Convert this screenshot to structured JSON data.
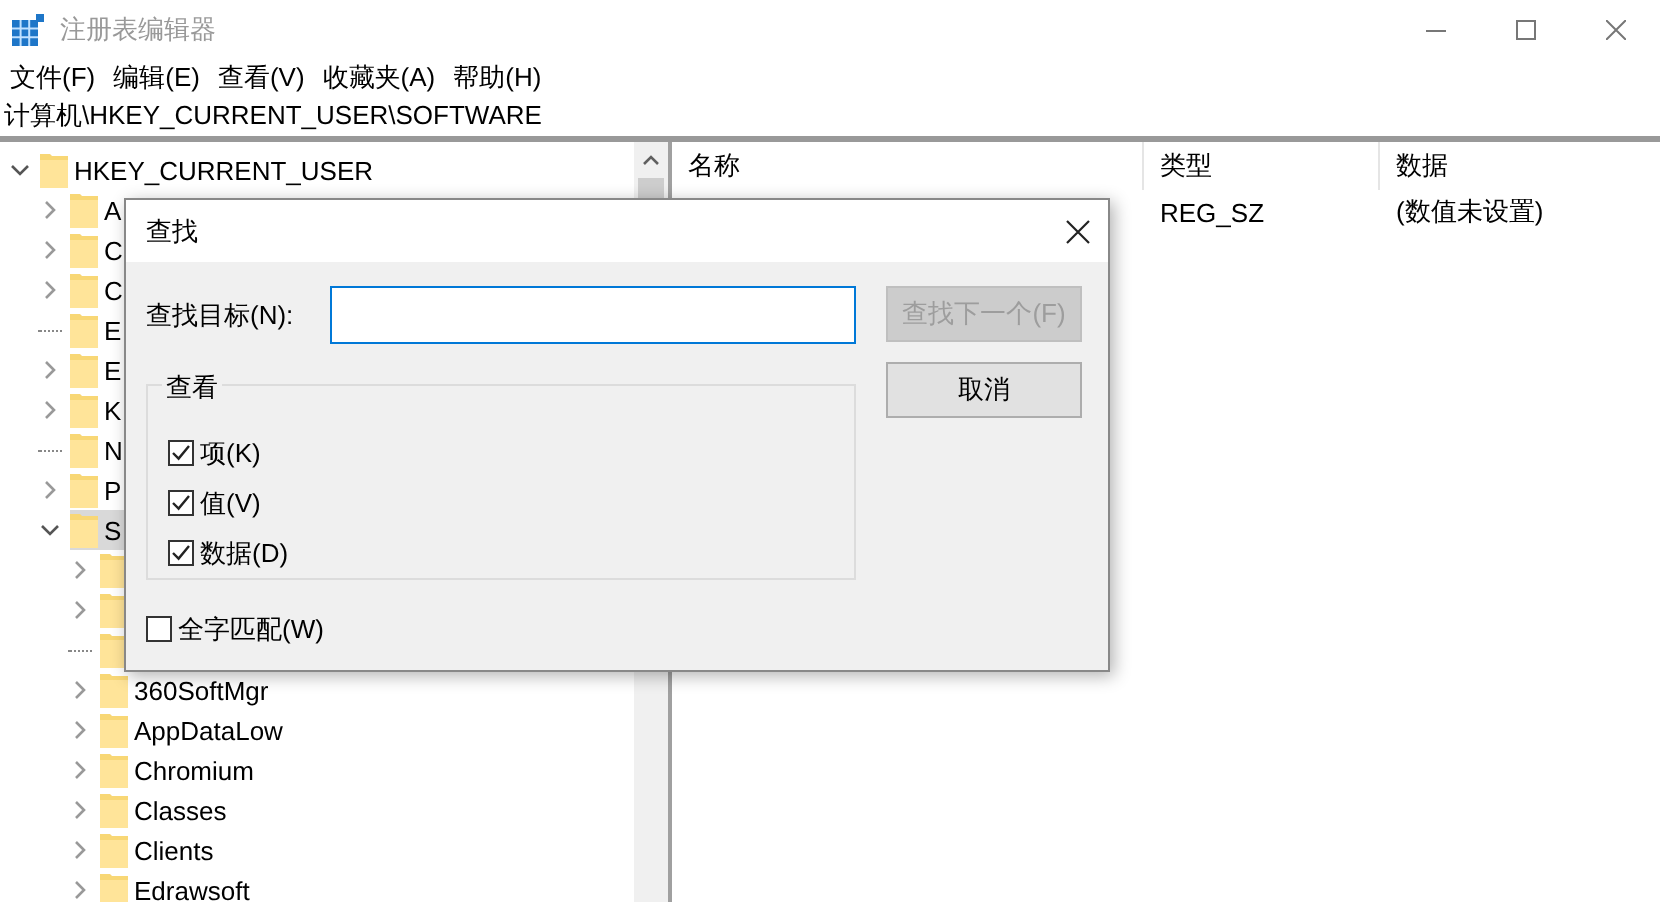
{
  "window": {
    "title": "注册表编辑器",
    "active": false
  },
  "menu": [
    "文件(F)",
    "编辑(E)",
    "查看(V)",
    "收藏夹(A)",
    "帮助(H)"
  ],
  "address": "计算机\\HKEY_CURRENT_USER\\SOFTWARE",
  "tree": [
    {
      "label": "HKEY_CURRENT_USER",
      "has_children": true,
      "expanded": true,
      "selected": false,
      "children": [
        {
          "label": "A",
          "has_children": true,
          "expanded": false,
          "selected": false
        },
        {
          "label": "C",
          "has_children": true,
          "expanded": false,
          "selected": false
        },
        {
          "label": "C",
          "has_children": true,
          "expanded": false,
          "selected": false
        },
        {
          "label": "E",
          "has_children": false,
          "expanded": false,
          "selected": false
        },
        {
          "label": "E",
          "has_children": true,
          "expanded": false,
          "selected": false
        },
        {
          "label": "K",
          "has_children": true,
          "expanded": false,
          "selected": false
        },
        {
          "label": "N",
          "has_children": false,
          "expanded": false,
          "selected": false
        },
        {
          "label": "P",
          "has_children": true,
          "expanded": false,
          "selected": false
        },
        {
          "label": "S",
          "has_children": true,
          "expanded": true,
          "selected": true,
          "children": [
            {
              "has_children": true,
              "expanded": false,
              "selected": false
            },
            {
              "has_children": true,
              "expanded": false,
              "selected": false
            },
            {
              "has_children": false,
              "expanded": false,
              "selected": false
            },
            {
              "label": "360SoftMgr",
              "has_children": true,
              "expanded": false,
              "selected": false
            },
            {
              "label": "AppDataLow",
              "has_children": true,
              "expanded": false,
              "selected": false
            },
            {
              "label": "Chromium",
              "has_children": true,
              "expanded": false,
              "selected": false
            },
            {
              "label": "Classes",
              "has_children": true,
              "expanded": false,
              "selected": false
            },
            {
              "label": "Clients",
              "has_children": true,
              "expanded": false,
              "selected": false
            },
            {
              "label": "Edrawsoft",
              "has_children": true,
              "expanded": false,
              "selected": false
            }
          ]
        }
      ]
    }
  ],
  "list": {
    "columns": [
      "名称",
      "类型",
      "数据"
    ],
    "rows": [
      {
        "type": "REG_SZ",
        "data": "(数值未设置)"
      }
    ]
  },
  "dialog": {
    "title": "查找",
    "find_label": "查找目标(N):",
    "buttons": [
      {
        "label": "查找下一个(F)",
        "disabled": true
      },
      {
        "label": "取消",
        "disabled": false
      }
    ],
    "group": {
      "title": "查看",
      "options": [
        {
          "label": "项(K)",
          "checked": true
        },
        {
          "label": "值(V)",
          "checked": true
        },
        {
          "label": "数据(D)",
          "checked": true
        }
      ]
    },
    "match_whole": {
      "label": "全字匹配(W)",
      "checked": false
    }
  }
}
